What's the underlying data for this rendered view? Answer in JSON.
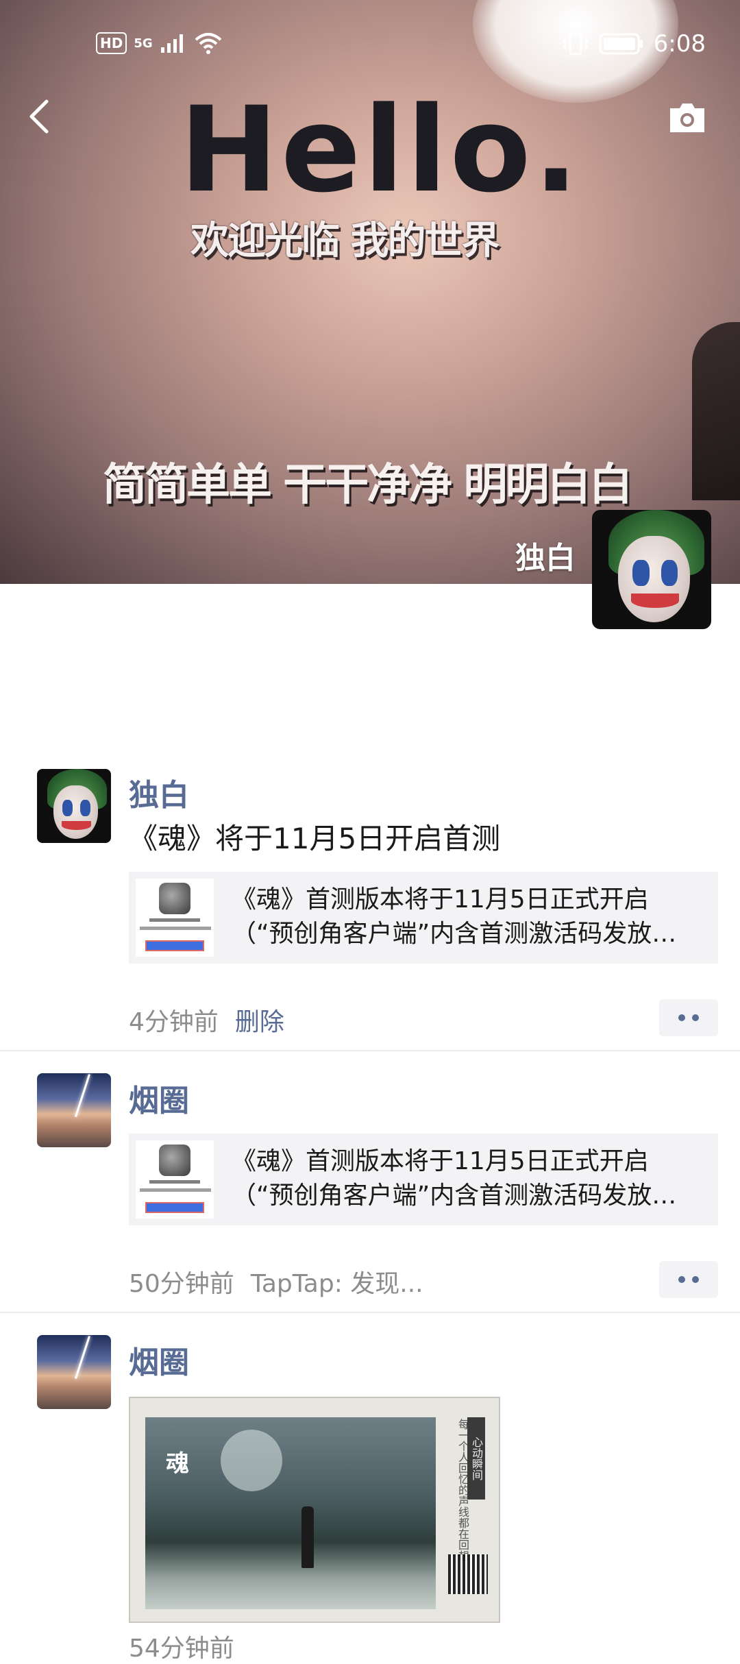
{
  "status_bar": {
    "hd": "HD",
    "network": "5G",
    "time": "6:08"
  },
  "cover": {
    "headline": "Hello.",
    "line1": "欢迎光临 我的世界",
    "line2": "简简单单 干干净净 明明白白",
    "username": "独白"
  },
  "posts": [
    {
      "author": "独白",
      "text": "《魂》将于11月5日开启首测",
      "link_line1": "《魂》首测版本将于11月5日正式开启",
      "link_line2": "（“预创角客户端”内含首测激活码发放…",
      "time": "4分钟前",
      "action": "删除"
    },
    {
      "author": "烟圈",
      "link_line1": "《魂》首测版本将于11月5日正式开启",
      "link_line2": "（“预创角客户端”内含首测激活码发放…",
      "time": "50分钟前",
      "source": "TapTap: 发现..."
    },
    {
      "author": "烟圈",
      "image_title": "魂",
      "image_seal": "心动瞬间",
      "image_caption": "每一个人回忆的声线都在回想",
      "time": "54分钟前"
    }
  ]
}
